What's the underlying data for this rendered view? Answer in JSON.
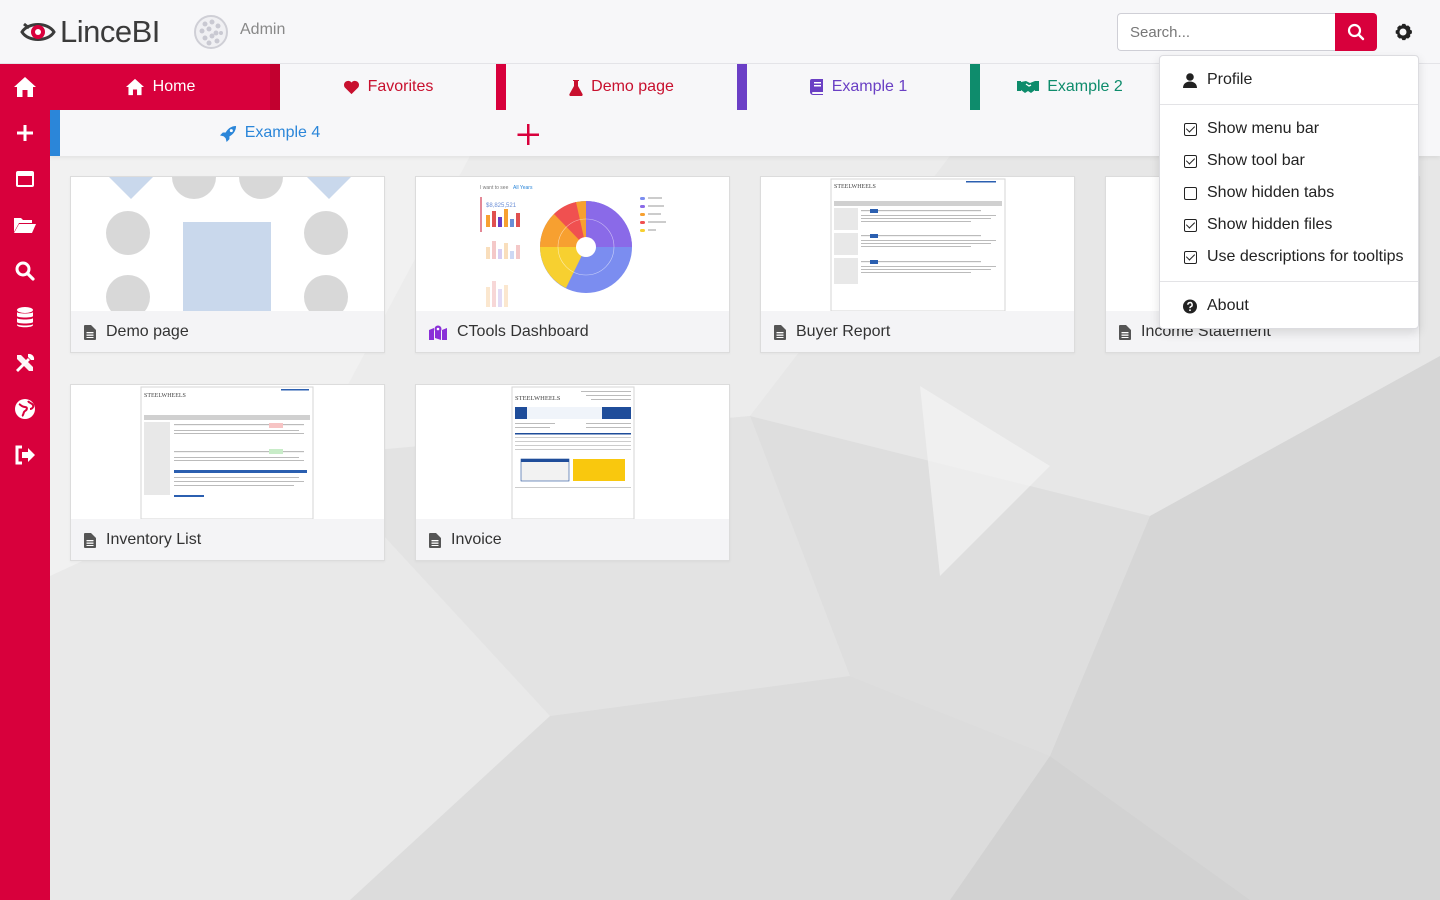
{
  "app": {
    "name": "LinceBI"
  },
  "header": {
    "user_name": "Admin",
    "search_placeholder": "Search..."
  },
  "tabs": [
    {
      "label": "Home",
      "icon": "home-icon",
      "color": "#d8003c",
      "active": true
    },
    {
      "label": "Favorites",
      "icon": "heart-icon",
      "color": "#c8102e"
    },
    {
      "label": "Demo page",
      "icon": "flask-icon",
      "color": "#c8102e"
    },
    {
      "label": "Example 1",
      "icon": "book-icon",
      "color": "#6a3fc4"
    },
    {
      "label": "Example 2",
      "icon": "handshake-icon",
      "color": "#0e8c6c"
    },
    {
      "label": "Example 4",
      "icon": "rocket-icon",
      "color": "#2b86d9"
    }
  ],
  "sidebar": {
    "items": [
      {
        "icon": "home-icon"
      },
      {
        "icon": "plus-icon"
      },
      {
        "icon": "window-icon"
      },
      {
        "icon": "folder-open-icon"
      },
      {
        "icon": "search-icon"
      },
      {
        "icon": "database-icon"
      },
      {
        "icon": "tools-icon"
      },
      {
        "icon": "globe-icon"
      },
      {
        "icon": "sign-out-icon"
      }
    ]
  },
  "cards": [
    {
      "title": "Demo page",
      "icon": "file-icon"
    },
    {
      "title": "CTools Dashboard",
      "icon": "map-marked-icon"
    },
    {
      "title": "Buyer Report",
      "icon": "file-icon"
    },
    {
      "title": "Income Statement",
      "icon": "file-icon"
    },
    {
      "title": "Inventory List",
      "icon": "file-icon"
    },
    {
      "title": "Invoice",
      "icon": "file-icon"
    }
  ],
  "thumbnails": {
    "brand": "STEELWHEELS",
    "dashboard_filter_label": "I want to see",
    "dashboard_filter_value": "All Years",
    "dashboard_total": "$8,825,521"
  },
  "settings_menu": {
    "profile": "Profile",
    "options": [
      {
        "label": "Show menu bar",
        "checked": true
      },
      {
        "label": "Show tool bar",
        "checked": true
      },
      {
        "label": "Show hidden tabs",
        "checked": false
      },
      {
        "label": "Show hidden files",
        "checked": true
      },
      {
        "label": "Use descriptions for tooltips",
        "checked": true
      }
    ],
    "about": "About"
  },
  "colors": {
    "accent": "#d8003c",
    "example1": "#6a3fc4",
    "example2": "#0e8c6c",
    "example4": "#2b86d9"
  }
}
